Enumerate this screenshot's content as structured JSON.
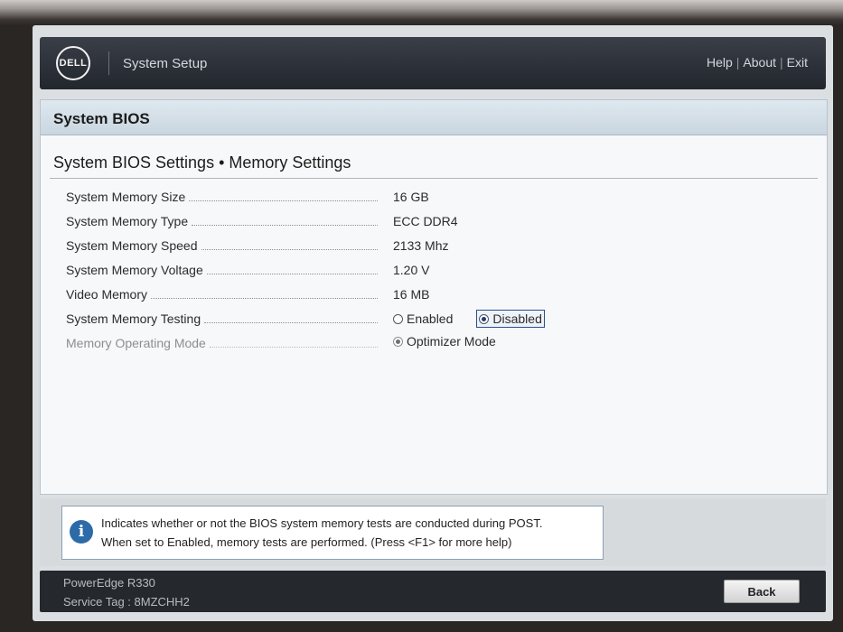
{
  "header": {
    "logo_text": "DELL",
    "app_title": "System Setup",
    "links": [
      "Help",
      "About",
      "Exit"
    ]
  },
  "section_title": "System BIOS",
  "page_heading": "System BIOS Settings • Memory Settings",
  "settings": [
    {
      "label": "System Memory Size",
      "value": "16 GB"
    },
    {
      "label": "System Memory Type",
      "value": "ECC DDR4"
    },
    {
      "label": "System Memory Speed",
      "value": "2133 Mhz"
    },
    {
      "label": "System Memory Voltage",
      "value": "1.20 V"
    },
    {
      "label": "Video Memory",
      "value": "16 MB"
    },
    {
      "label": "System Memory Testing",
      "options": [
        "Enabled",
        "Disabled"
      ],
      "selected": "Disabled"
    },
    {
      "label": "Memory Operating Mode",
      "options": [
        "Optimizer Mode"
      ],
      "selected": "Optimizer Mode",
      "disabled": true
    }
  ],
  "help": {
    "icon": "info-icon",
    "line1": "Indicates whether or not the BIOS system memory tests are conducted during POST.",
    "line2": "When set to Enabled, memory tests are performed. (Press <F1> for more help)"
  },
  "footer": {
    "model": "PowerEdge R330",
    "service_tag": "Service Tag : 8MZCHH2",
    "back_label": "Back"
  },
  "colors": {
    "header_bg": "#22262d",
    "section_bar": "#c9d6e0",
    "accent": "#2d6aa8",
    "footer_bg": "#25292e"
  }
}
